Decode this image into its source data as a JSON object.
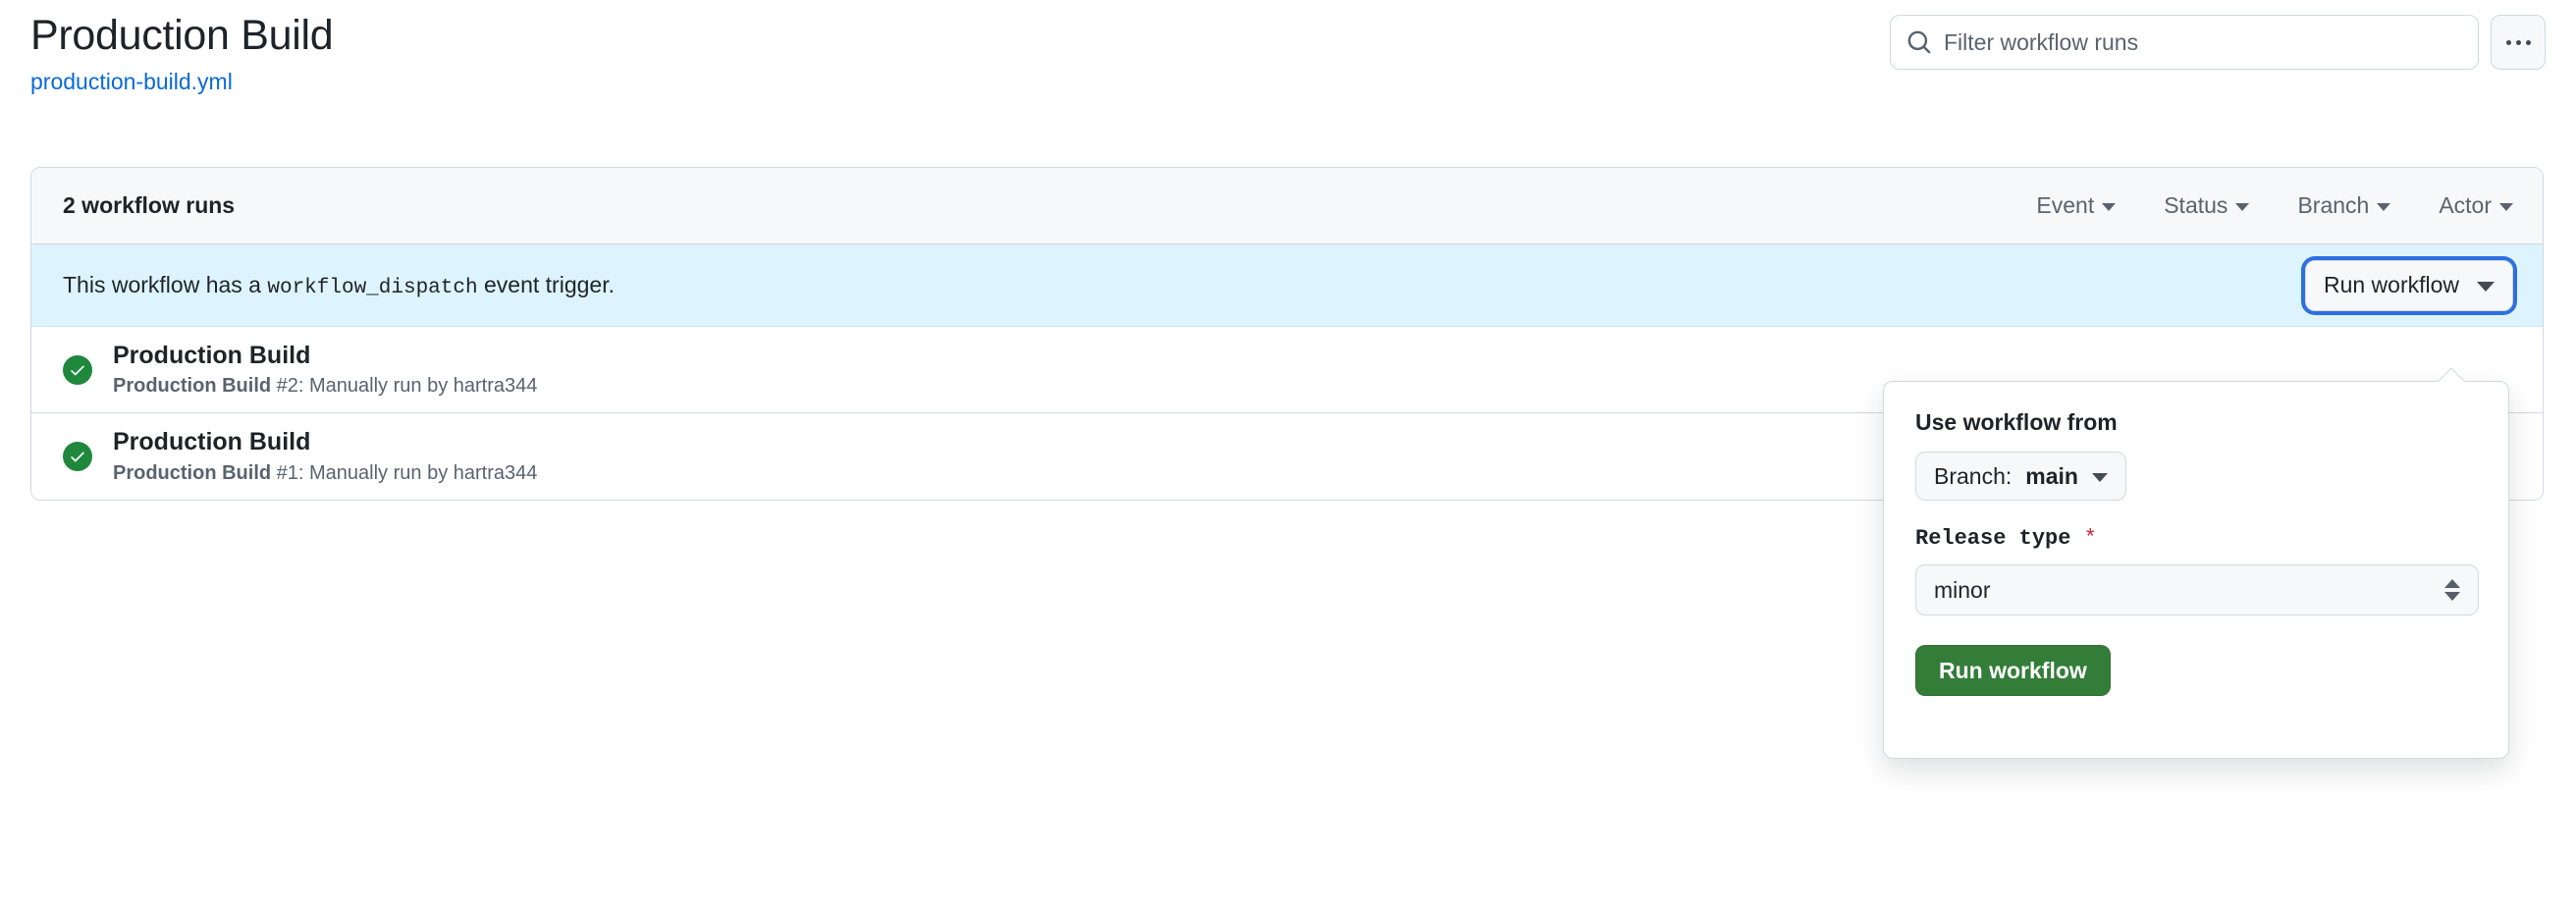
{
  "header": {
    "title": "Production Build",
    "file_link": "production-build.yml",
    "search": {
      "placeholder": "Filter workflow runs",
      "value": "",
      "icon": "search-icon"
    },
    "kebab_label": "…",
    "kebab_icon": "kebab-horizontal-icon"
  },
  "toolbar": {
    "runs_count": "2 workflow runs",
    "filters": [
      {
        "label": "Event"
      },
      {
        "label": "Status"
      },
      {
        "label": "Branch"
      },
      {
        "label": "Actor"
      }
    ]
  },
  "dispatch_banner": {
    "text_before": "This workflow has a",
    "event_name": "workflow_dispatch",
    "text_after": "event trigger.",
    "run_button_label": "Run workflow"
  },
  "runs": [
    {
      "status": "success",
      "status_icon": "check-circle-icon",
      "title": "Production Build",
      "sub_workflow": "Production Build",
      "sub_rest": "#2: Manually run by hartra344"
    },
    {
      "status": "success",
      "status_icon": "check-circle-icon",
      "title": "Production Build",
      "sub_workflow": "Production Build",
      "sub_rest": "#1: Manually run by hartra344"
    }
  ],
  "dispatch_panel": {
    "use_workflow_from_label": "Use workflow from",
    "branch_prefix": "Branch:",
    "branch_value": "main",
    "release_type_label": "Release type",
    "required_marker": "*",
    "release_type_value": "minor",
    "release_type_options": [
      "minor"
    ],
    "submit_label": "Run workflow"
  },
  "colors": {
    "link": "#0969da",
    "success_green": "#1f883d",
    "button_green": "#347d39",
    "banner_blue": "#ddf4ff",
    "focus_blue": "#2d6fe0",
    "required_red": "#cf222e",
    "muted_text": "#59636e",
    "border": "#d1d9e0"
  }
}
